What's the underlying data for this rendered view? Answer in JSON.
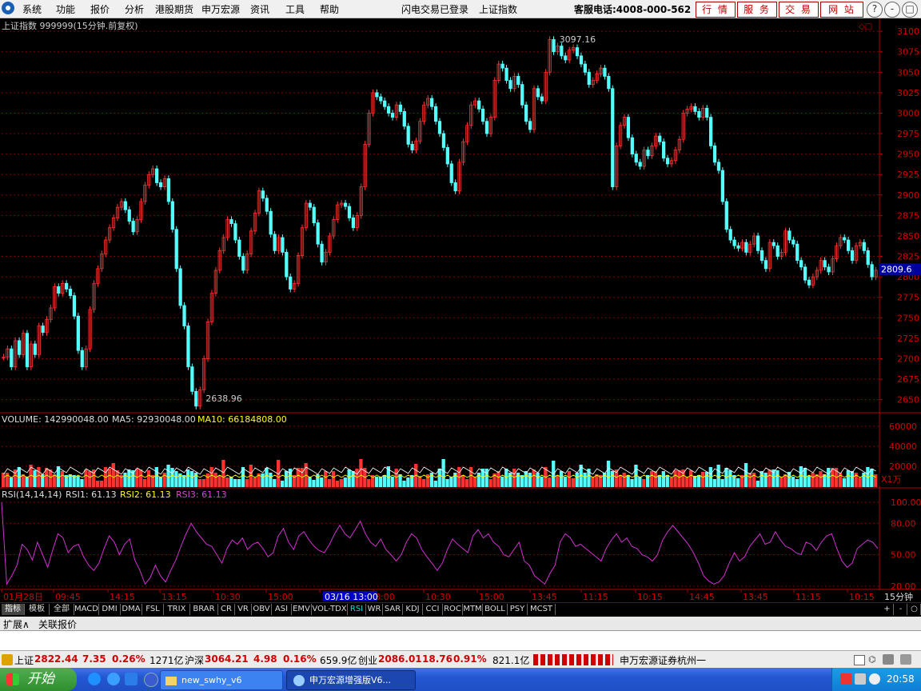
{
  "menu": {
    "items": [
      "系统",
      "功能",
      "报价",
      "分析",
      "港股期货",
      "申万宏源",
      "资讯",
      "工具",
      "帮助"
    ],
    "notice1": "闪电交易已登录",
    "notice2": "上证指数",
    "hotline": "客服电话:4008-000-562",
    "buttons": [
      "行 情",
      "服 务",
      "交 易",
      "网 站"
    ],
    "window_buttons": [
      "?",
      "-",
      "□",
      "×"
    ]
  },
  "chart_data": {
    "type": "candlestick",
    "title": "上证指数 999999(15分钟.前复权)",
    "price_ticks": [
      3100,
      3075,
      3050,
      3025,
      3000,
      2975,
      2950,
      2925,
      2900,
      2875,
      2850,
      2825,
      2800,
      2775,
      2750,
      2725,
      2700,
      2675,
      2650
    ],
    "ylim": [
      2634,
      3106
    ],
    "high_label": "3097.16",
    "low_label": "2638.96",
    "current_price": "2809.6",
    "price_path": [
      2702,
      2712,
      2690,
      2722,
      2705,
      2731,
      2690,
      2718,
      2705,
      2740,
      2732,
      2748,
      2762,
      2788,
      2780,
      2792,
      2785,
      2777,
      2752,
      2710,
      2690,
      2712,
      2760,
      2792,
      2810,
      2828,
      2845,
      2860,
      2872,
      2885,
      2892,
      2882,
      2868,
      2855,
      2870,
      2892,
      2912,
      2925,
      2932,
      2915,
      2910,
      2920,
      2892,
      2858,
      2810,
      2765,
      2740,
      2690,
      2660,
      2642,
      2662,
      2700,
      2745,
      2780,
      2808,
      2832,
      2848,
      2870,
      2865,
      2845,
      2825,
      2808,
      2828,
      2856,
      2878,
      2905,
      2896,
      2880,
      2852,
      2832,
      2848,
      2830,
      2800,
      2785,
      2792,
      2826,
      2860,
      2890,
      2885,
      2866,
      2840,
      2818,
      2830,
      2850,
      2870,
      2888,
      2890,
      2886,
      2872,
      2860,
      2875,
      2910,
      2962,
      3000,
      3025,
      3020,
      3015,
      3008,
      3000,
      2995,
      3010,
      3002,
      2984,
      2962,
      2955,
      2966,
      2990,
      3010,
      3018,
      3008,
      2990,
      2975,
      2958,
      2938,
      2915,
      2905,
      2940,
      2965,
      2985,
      3010,
      3015,
      3005,
      2990,
      2975,
      2995,
      3040,
      3060,
      3055,
      3040,
      3030,
      3045,
      3035,
      3010,
      2990,
      2980,
      3030,
      3020,
      3015,
      3050,
      3090,
      3075,
      3082,
      3070,
      3065,
      3077,
      3080,
      3070,
      3060,
      3050,
      3035,
      3040,
      3048,
      3055,
      3045,
      3030,
      2910,
      2960,
      2985,
      2995,
      2970,
      2950,
      2940,
      2935,
      2955,
      2948,
      2960,
      2972,
      2965,
      2945,
      2938,
      2942,
      2955,
      2968,
      3000,
      3005,
      3008,
      3002,
      2995,
      3006,
      2995,
      2960,
      2940,
      2930,
      2892,
      2858,
      2845,
      2838,
      2835,
      2842,
      2830,
      2840,
      2850,
      2832,
      2820,
      2810,
      2842,
      2838,
      2825,
      2830,
      2856,
      2845,
      2840,
      2820,
      2812,
      2796,
      2790,
      2800,
      2808,
      2820,
      2812,
      2806,
      2822,
      2838,
      2848,
      2845,
      2832,
      2820,
      2838,
      2842,
      2832,
      2815,
      2800,
      2808
    ],
    "volume_label": "VOLUME: 142990048.00",
    "ma5_label": "MA5: 92930048.00",
    "ma10_label": "MA10: 66184808.00",
    "volume_ticks": [
      "60000",
      "40000",
      "20000"
    ],
    "volume_unit": "X1万",
    "rsi_label": "RSI(14,14,14)",
    "rsi1_label": "RSI1: 61.13",
    "rsi2_label": "RSI2: 61.13",
    "rsi3_label": "RSI3: 61.13",
    "rsi_ticks": [
      "100.00",
      "80.00",
      "50.00",
      "20.00"
    ],
    "rsi_path": [
      100,
      22,
      30,
      40,
      60,
      55,
      45,
      62,
      50,
      38,
      55,
      70,
      66,
      52,
      58,
      60,
      48,
      40,
      35,
      42,
      56,
      68,
      62,
      50,
      60,
      65,
      45,
      35,
      22,
      28,
      40,
      30,
      24,
      35,
      45,
      58,
      70,
      80,
      72,
      66,
      60,
      58,
      50,
      42,
      56,
      64,
      60,
      66,
      55,
      60,
      62,
      56,
      48,
      52,
      68,
      75,
      62,
      55,
      68,
      72,
      64,
      58,
      54,
      52,
      60,
      70,
      78,
      70,
      66,
      74,
      82,
      70,
      62,
      58,
      65,
      55,
      50,
      44,
      50,
      62,
      70,
      66,
      55,
      48,
      42,
      35,
      42,
      55,
      65,
      60,
      56,
      52,
      68,
      74,
      66,
      70,
      62,
      58,
      50,
      48,
      55,
      62,
      44,
      40,
      30,
      26,
      22,
      32,
      40,
      62,
      70,
      66,
      58,
      60,
      56,
      52,
      48,
      44,
      56,
      64,
      70,
      62,
      66,
      58,
      56,
      50,
      48,
      44,
      50,
      64,
      72,
      78,
      72,
      66,
      60,
      52,
      42,
      30,
      25,
      22,
      24,
      30,
      42,
      52,
      44,
      48,
      58,
      64,
      70,
      60,
      62,
      72,
      64,
      58,
      56,
      52,
      50,
      62,
      60,
      54,
      62,
      68,
      70,
      56,
      44,
      38,
      42,
      56,
      60,
      64,
      62,
      56
    ],
    "time_ticks": [
      "01月28日",
      "09:45",
      "14:15",
      "13:15",
      "10:30",
      "15:00",
      "10:15",
      "03/16 13:00",
      "3:00",
      "10:30",
      "15:00",
      "13:45",
      "11:15",
      "10:15",
      "14:45",
      "13:45",
      "11:15",
      "10:15"
    ],
    "period": "15分钟"
  },
  "indicator_tabs": [
    "指标",
    "模板",
    "全部",
    "MACD",
    "DMI",
    "DMA",
    "FSL",
    "TRIX",
    "BRAR",
    "CR",
    "VR",
    "OBV",
    "ASI",
    "EMV",
    "VOL-TDX",
    "RSI",
    "WR",
    "SAR",
    "KDJ",
    "CCI",
    "ROC",
    "MTM",
    "BOLL",
    "PSY",
    "MCST"
  ],
  "zoom_buttons": [
    "+",
    "-",
    "○"
  ],
  "bottom_tabs": [
    "扩展∧",
    "关联报价"
  ],
  "status": {
    "sh_label": "上证",
    "sh_value": "2822.44",
    "sh_change": "7.35",
    "sh_pct": "0.26%",
    "sh_amount": "1271亿",
    "hs_label": "沪深",
    "hs_value": "3064.21",
    "hs_change": "4.98",
    "hs_pct": "0.16%",
    "hs_amount": "659.9亿",
    "cy_label": "创业",
    "cy_value": "2086.01",
    "cy_change": "18.76",
    "cy_pct": "0.91%",
    "cy_amount": "821.1亿",
    "broker": "申万宏源证券杭州一"
  },
  "taskbar": {
    "start": "开始",
    "item1": "new_swhy_v6",
    "item2": "申万宏源增强版V6...",
    "time": "20:58"
  }
}
